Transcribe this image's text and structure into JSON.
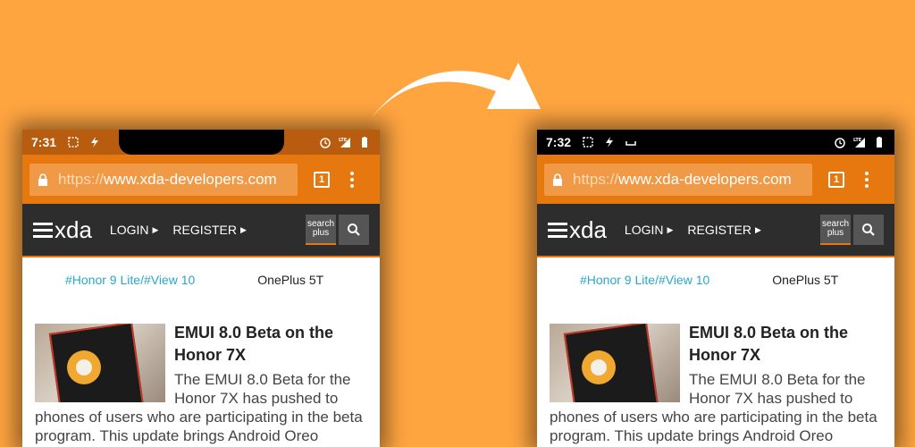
{
  "left_phone": {
    "status": {
      "time": "7:31"
    },
    "url_bar": {
      "proto": "https://",
      "host": "www.xda-developers.com",
      "tabs_count": "1"
    },
    "nav": {
      "logo": "xda",
      "login": "LOGIN",
      "register": "REGISTER",
      "search_plus_line1": "search",
      "search_plus_line2": "plus"
    },
    "topics": {
      "link1": "#Honor 9 Lite",
      "sep": "/",
      "link2": "#View 10",
      "plain": "OnePlus 5T"
    },
    "article": {
      "title": "EMUI 8.0 Beta on the Honor 7X",
      "body": "The EMUI 8.0 Beta for the Honor 7X has pushed to phones of users who are participating in the beta program. This update brings Android Oreo"
    }
  },
  "right_phone": {
    "status": {
      "time": "7:32"
    },
    "url_bar": {
      "proto": "https://",
      "host": "www.xda-developers.com",
      "tabs_count": "1"
    },
    "nav": {
      "logo": "xda",
      "login": "LOGIN",
      "register": "REGISTER",
      "search_plus_line1": "search",
      "search_plus_line2": "plus"
    },
    "topics": {
      "link1": "#Honor 9 Lite",
      "sep": "/",
      "link2": "#View 10",
      "plain": "OnePlus 5T"
    },
    "article": {
      "title": "EMUI 8.0 Beta on the Honor 7X",
      "body": "The EMUI 8.0 Beta for the Honor 7X has pushed to phones of users who are participating in the beta program. This update brings Android Oreo"
    }
  },
  "colors": {
    "background": "#FFA540",
    "url_bar": "#E6780F",
    "nav_bar": "#2d2d2d",
    "topic_link": "#2AA7C9"
  },
  "icons": [
    "screenshot-icon",
    "flash-icon",
    "alarm-icon",
    "lte-signal-icon",
    "battery-icon",
    "lock-icon",
    "search-icon",
    "arrow-icon"
  ]
}
